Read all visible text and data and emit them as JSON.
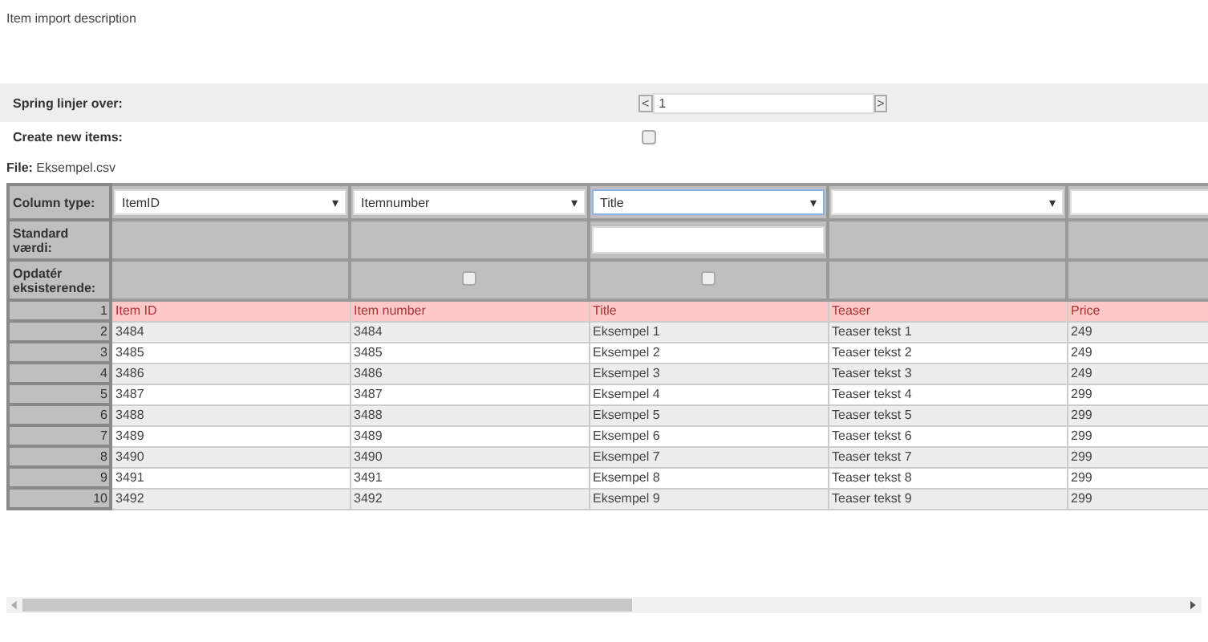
{
  "description": "Item import description",
  "skip_lines": {
    "label": "Spring linjer over:",
    "prev": "<",
    "value": "1",
    "next": ">"
  },
  "create_new": {
    "label": "Create new items:",
    "checked": false
  },
  "file": {
    "label": "File:",
    "name": "Eksempel.csv"
  },
  "table": {
    "row_labels": {
      "column_type": "Column type:",
      "default": "Standard værdi:",
      "update": "Opdatér eksisterende:"
    },
    "columns": [
      {
        "type": "ItemID",
        "arrow": "▾",
        "focused": false,
        "default_field": false
      },
      {
        "type": "Itemnumber",
        "arrow": "▾",
        "focused": false,
        "default_field": false,
        "update": {
          "checked": false
        }
      },
      {
        "type": "Title",
        "arrow": "▾",
        "focused": true,
        "default_field": true,
        "update": {
          "checked": false
        }
      },
      {
        "arrow": "▾",
        "focused": false,
        "default_field": false
      },
      {
        "focused": false,
        "default_field": false
      }
    ],
    "rows": [
      {
        "number": "1",
        "kind": "header",
        "cells": [
          "Item ID",
          "Item number",
          "Title",
          "Teaser",
          "Price"
        ]
      },
      {
        "number": "2",
        "kind": "data",
        "cells": [
          "3484",
          "3484",
          "Eksempel 1",
          "Teaser tekst 1",
          "249"
        ]
      },
      {
        "number": "3",
        "kind": "data",
        "cells": [
          "3485",
          "3485",
          "Eksempel 2",
          "Teaser tekst 2",
          "249"
        ]
      },
      {
        "number": "4",
        "kind": "data",
        "cells": [
          "3486",
          "3486",
          "Eksempel 3",
          "Teaser tekst 3",
          "249"
        ]
      },
      {
        "number": "5",
        "kind": "data",
        "cells": [
          "3487",
          "3487",
          "Eksempel 4",
          "Teaser tekst 4",
          "299"
        ]
      },
      {
        "number": "6",
        "kind": "data",
        "cells": [
          "3488",
          "3488",
          "Eksempel 5",
          "Teaser tekst 5",
          "299"
        ]
      },
      {
        "number": "7",
        "kind": "data",
        "cells": [
          "3489",
          "3489",
          "Eksempel 6",
          "Teaser tekst 6",
          "299"
        ]
      },
      {
        "number": "8",
        "kind": "data",
        "cells": [
          "3490",
          "3490",
          "Eksempel 7",
          "Teaser tekst 7",
          "299"
        ]
      },
      {
        "number": "9",
        "kind": "data",
        "cells": [
          "3491",
          "3491",
          "Eksempel 8",
          "Teaser tekst 8",
          "299"
        ]
      },
      {
        "number": "10",
        "kind": "data",
        "cells": [
          "3492",
          "3492",
          "Eksempel 9",
          "Teaser tekst 9",
          "299"
        ]
      }
    ]
  }
}
